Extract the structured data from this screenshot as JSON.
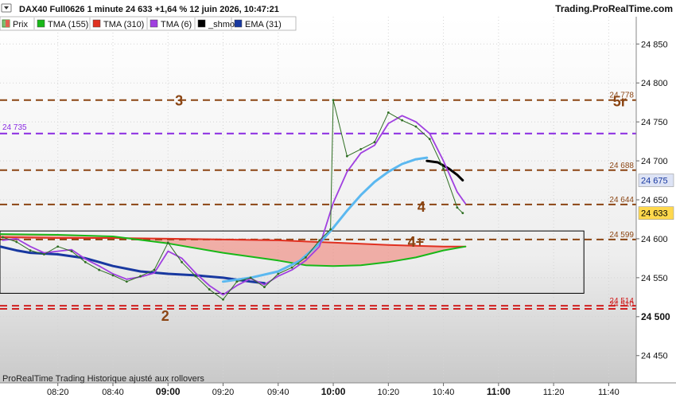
{
  "header": {
    "instrument": "DAX40 Full0626 1 minute 24 633 +1,64 % 12 juin 2026, 10:47:21",
    "brand": "Trading.ProRealTime.com"
  },
  "legend": [
    {
      "label": "Prix",
      "color": "#4a9a3f",
      "swatch": "candle"
    },
    {
      "label": "TMA (155)",
      "color": "#18b818"
    },
    {
      "label": "TMA (310)",
      "color": "#e03020"
    },
    {
      "label": "TMA (6)",
      "color": "#a040e0"
    },
    {
      "label": "_shmo",
      "color": "#000000"
    },
    {
      "label": "EMA (31)",
      "color": "#1838a0"
    }
  ],
  "footer": {
    "note": "ProRealTime Trading  Historique ajusté aux rollovers"
  },
  "chart_data": {
    "type": "line",
    "x_unit": "time (hh:mm), 1-minute bars, 12 juin 2026",
    "xlim": [
      "07:59",
      "11:50"
    ],
    "ylim": [
      24415,
      24885
    ],
    "x_ticks": [
      "08:20",
      "08:40",
      "09:00",
      "09:20",
      "09:40",
      "10:00",
      "10:20",
      "10:40",
      "11:00",
      "11:20",
      "11:40"
    ],
    "x_ticks_bold": [
      "09:00",
      "10:00",
      "11:00"
    ],
    "y_ticks": [
      24850,
      24800,
      24750,
      24700,
      24650,
      24600,
      24550,
      24500,
      24450
    ],
    "y_ticks_bold": [
      24500
    ],
    "grid": true,
    "last_price": 24633,
    "levels": [
      {
        "value": 24778,
        "label": "24 778",
        "color": "#8b4513",
        "style": "dashed",
        "right_label": true
      },
      {
        "value": 24735,
        "label": "24 735",
        "color": "#8a2be2",
        "style": "dashed",
        "left_label": true
      },
      {
        "value": 24688,
        "label": "24 688",
        "color": "#8b4513",
        "style": "dashed",
        "right_label": true
      },
      {
        "value": 24644,
        "label": "24 644",
        "color": "#8b4513",
        "style": "dashed",
        "right_label": true
      },
      {
        "value": 24599,
        "label": "24 599",
        "color": "#8b4513",
        "style": "dashed",
        "right_label": true
      },
      {
        "value": 24514,
        "label": "24 514",
        "color": "#d02020",
        "style": "dashed",
        "right_label": true
      },
      {
        "value": 24510,
        "label": "24 510",
        "color": "#d02020",
        "style": "dashed",
        "right_label": true
      }
    ],
    "axis_badges": [
      {
        "value": 24675,
        "label": "24 675",
        "color": "#1838a0",
        "bg": "#dde3f5"
      },
      {
        "value": 24633,
        "label": "24 633",
        "color": "#000000",
        "bg": "#ffd84d"
      }
    ],
    "annotations": [
      {
        "text": "3",
        "x": "09:04",
        "y": 24778
      },
      {
        "text": "5r",
        "x": "11:44",
        "y": 24777
      },
      {
        "text": "4",
        "x": "10:32",
        "y": 24642
      },
      {
        "text": "4+",
        "x": "10:30",
        "y": 24597
      },
      {
        "text": "2",
        "x": "08:59",
        "y": 24502
      }
    ],
    "range_box": {
      "x_start": "07:59",
      "x_end": "11:31",
      "y_top": 24610,
      "y_bottom": 24530
    },
    "series": [
      {
        "name": "TMA (310)",
        "color": "#e03020",
        "x": [
          "07:59",
          "08:20",
          "08:40",
          "09:00",
          "09:20",
          "09:40",
          "10:00",
          "10:20",
          "10:40",
          "10:48"
        ],
        "values": [
          24602,
          24601,
          24601,
          24600,
          24599,
          24598,
          24595,
          24592,
          24590,
          24590
        ]
      },
      {
        "name": "TMA (155)",
        "color": "#18b818",
        "x": [
          "07:59",
          "08:20",
          "08:40",
          "09:00",
          "09:20",
          "09:40",
          "09:50",
          "10:00",
          "10:10",
          "10:20",
          "10:30",
          "10:40",
          "10:48"
        ],
        "values": [
          24606,
          24605,
          24603,
          24594,
          24582,
          24572,
          24566,
          24565,
          24566,
          24570,
          24576,
          24585,
          24590
        ]
      },
      {
        "name": "EMA (31)",
        "color": "#1838a0",
        "x": [
          "07:59",
          "08:05",
          "08:10",
          "08:20",
          "08:30",
          "08:40",
          "08:50",
          "09:00",
          "09:10",
          "09:20",
          "09:30",
          "09:35"
        ],
        "values": [
          24590,
          24585,
          24582,
          24580,
          24575,
          24565,
          24558,
          24555,
          24553,
          24550,
          24545,
          24543
        ]
      },
      {
        "name": "_shmo",
        "color": "#000000",
        "x": [
          "10:34",
          "10:38",
          "10:42",
          "10:45",
          "10:47"
        ],
        "values": [
          24700,
          24698,
          24690,
          24682,
          24675
        ]
      },
      {
        "name": "",
        "color": "#5bb8f0",
        "x": [
          "09:20",
          "09:30",
          "09:40",
          "09:48",
          "09:55",
          "10:00",
          "10:05",
          "10:10",
          "10:15",
          "10:20",
          "10:25",
          "10:30",
          "10:34"
        ],
        "values": [
          24545,
          24550,
          24558,
          24572,
          24594,
          24614,
          24636,
          24656,
          24673,
          24686,
          24696,
          24702,
          24704
        ]
      },
      {
        "name": "TMA (6)",
        "color": "#a040e0",
        "x": [
          "08:00",
          "08:05",
          "08:10",
          "08:15",
          "08:20",
          "08:25",
          "08:30",
          "08:35",
          "08:40",
          "08:45",
          "08:50",
          "08:55",
          "09:00",
          "09:05",
          "09:10",
          "09:15",
          "09:20",
          "09:25",
          "09:30",
          "09:35",
          "09:40",
          "09:45",
          "09:50",
          "09:55",
          "10:00",
          "10:05",
          "10:10",
          "10:15",
          "10:20",
          "10:25",
          "10:30",
          "10:35",
          "10:40",
          "10:45",
          "10:48"
        ],
        "values": [
          24598,
          24600,
          24590,
          24582,
          24584,
          24586,
          24574,
          24565,
          24555,
          24548,
          24551,
          24556,
          24584,
          24575,
          24556,
          24540,
          24528,
          24540,
          24549,
          24541,
          24552,
          24560,
          24572,
          24590,
          24646,
          24686,
          24710,
          24720,
          24748,
          24758,
          24750,
          24735,
          24700,
          24660,
          24645
        ]
      },
      {
        "name": "Prix",
        "color": "#2e6e22",
        "x": [
          "08:00",
          "08:05",
          "08:10",
          "08:15",
          "08:20",
          "08:25",
          "08:30",
          "08:35",
          "08:40",
          "08:45",
          "08:50",
          "08:55",
          "09:00",
          "09:05",
          "09:10",
          "09:15",
          "09:20",
          "09:25",
          "09:30",
          "09:35",
          "09:40",
          "09:45",
          "09:50",
          "09:55",
          "09:59",
          "10:00",
          "10:05",
          "10:10",
          "10:15",
          "10:20",
          "10:25",
          "10:30",
          "10:35",
          "10:40",
          "10:45",
          "10:47"
        ],
        "values": [
          24602,
          24596,
          24585,
          24580,
          24590,
          24584,
          24570,
          24560,
          24553,
          24545,
          24552,
          24560,
          24595,
          24570,
          24552,
          24535,
          24522,
          24545,
          24550,
          24538,
          24555,
          24563,
          24576,
          24598,
          24612,
          24778,
          24706,
          24715,
          24724,
          24762,
          24752,
          24744,
          24728,
          24690,
          24640,
          24633
        ]
      }
    ]
  }
}
